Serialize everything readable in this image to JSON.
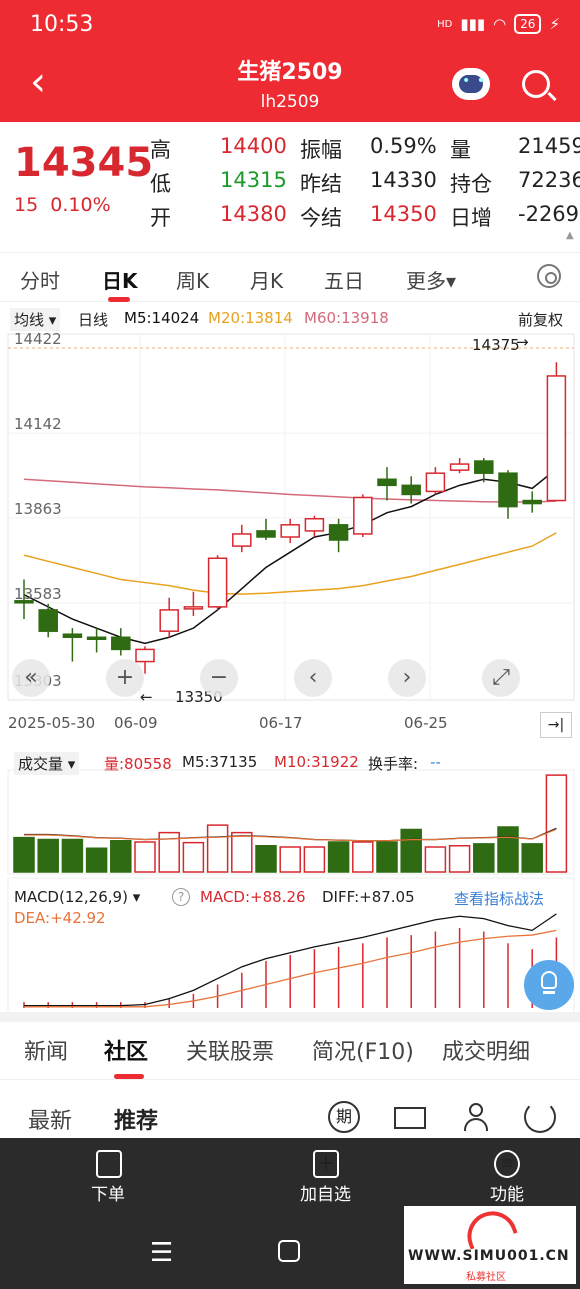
{
  "status": {
    "time": "10:53",
    "battery": "26",
    "signal": "HD",
    "icons": [
      "signal-icon",
      "wifi-icon",
      "battery-icon",
      "charging-icon"
    ]
  },
  "header": {
    "title": "生猪2509",
    "code": "lh2509"
  },
  "quote": {
    "price": "14345",
    "change": "15",
    "change_pct": "0.10%",
    "high_label": "高",
    "high": "14400",
    "low_label": "低",
    "low": "14315",
    "open_label": "开",
    "open": "14380",
    "amp_label": "振幅",
    "amp": "0.59%",
    "prev_settle_label": "昨结",
    "prev_settle": "14330",
    "today_settle_label": "今结",
    "today_settle": "14350",
    "vol_label": "量",
    "vol": "21459",
    "oi_label": "持仓",
    "oi": "72236",
    "oi_chg_label": "日增",
    "oi_chg": "-2269"
  },
  "tabs": [
    {
      "label": "分时"
    },
    {
      "label": "日K"
    },
    {
      "label": "周K"
    },
    {
      "label": "月K"
    },
    {
      "label": "五日"
    },
    {
      "label": "更多▾"
    }
  ],
  "ma_bar": {
    "type": "均线",
    "period": "日线",
    "m5": "M5:14024",
    "m20": "M20:13814",
    "m60": "M60:13918",
    "adjust": "前复权"
  },
  "kline": {
    "y_labels": [
      "14422",
      "14142",
      "13863",
      "13583",
      "13303"
    ],
    "x_labels": [
      "2025-05-30",
      "06-09",
      "06-17",
      "06-25"
    ],
    "max_label": "14375",
    "min_label": "13350",
    "colors": {
      "up": "#d8282f",
      "down": "#2e6b12",
      "m5": "#111111",
      "m20": "#e8a21e",
      "m60": "#d46a7a"
    }
  },
  "chart_data": {
    "type": "candlestick",
    "ylim": [
      13303,
      14422
    ],
    "candles": [
      {
        "o": 13590,
        "c": 13590,
        "h": 13660,
        "l": 13530,
        "up": false
      },
      {
        "o": 13560,
        "c": 13490,
        "h": 13580,
        "l": 13470,
        "up": false
      },
      {
        "o": 13480,
        "c": 13470,
        "h": 13500,
        "l": 13390,
        "up": false
      },
      {
        "o": 13470,
        "c": 13470,
        "h": 13500,
        "l": 13420,
        "up": false
      },
      {
        "o": 13470,
        "c": 13430,
        "h": 13500,
        "l": 13410,
        "up": false
      },
      {
        "o": 13390,
        "c": 13430,
        "h": 13440,
        "l": 13350,
        "up": true
      },
      {
        "o": 13490,
        "c": 13560,
        "h": 13600,
        "l": 13470,
        "up": true
      },
      {
        "o": 13570,
        "c": 13570,
        "h": 13620,
        "l": 13540,
        "up": true
      },
      {
        "o": 13570,
        "c": 13730,
        "h": 13740,
        "l": 13560,
        "up": true
      },
      {
        "o": 13770,
        "c": 13810,
        "h": 13840,
        "l": 13750,
        "up": true
      },
      {
        "o": 13820,
        "c": 13800,
        "h": 13860,
        "l": 13790,
        "up": false
      },
      {
        "o": 13800,
        "c": 13840,
        "h": 13860,
        "l": 13780,
        "up": true
      },
      {
        "o": 13820,
        "c": 13860,
        "h": 13870,
        "l": 13800,
        "up": true
      },
      {
        "o": 13840,
        "c": 13790,
        "h": 13860,
        "l": 13750,
        "up": false
      },
      {
        "o": 13810,
        "c": 13930,
        "h": 13940,
        "l": 13800,
        "up": true
      },
      {
        "o": 13990,
        "c": 13970,
        "h": 14030,
        "l": 13920,
        "up": false
      },
      {
        "o": 13970,
        "c": 13940,
        "h": 14000,
        "l": 13910,
        "up": false
      },
      {
        "o": 13950,
        "c": 14010,
        "h": 14030,
        "l": 13940,
        "up": true
      },
      {
        "o": 14020,
        "c": 14040,
        "h": 14060,
        "l": 14010,
        "up": true
      },
      {
        "o": 14050,
        "c": 14010,
        "h": 14060,
        "l": 13980,
        "up": false
      },
      {
        "o": 14010,
        "c": 13900,
        "h": 14020,
        "l": 13860,
        "up": false
      },
      {
        "o": 13920,
        "c": 13910,
        "h": 13950,
        "l": 13880,
        "up": false
      },
      {
        "o": 13920,
        "c": 14330,
        "h": 14375,
        "l": 13920,
        "up": true
      }
    ],
    "ma5": [
      13610,
      13570,
      13530,
      13500,
      13470,
      13450,
      13470,
      13500,
      13560,
      13630,
      13700,
      13750,
      13800,
      13815,
      13840,
      13880,
      13900,
      13940,
      13970,
      13990,
      13980,
      13960,
      14024
    ],
    "ma20": [
      13740,
      13720,
      13700,
      13680,
      13660,
      13650,
      13640,
      13625,
      13615,
      13612,
      13615,
      13620,
      13625,
      13630,
      13640,
      13655,
      13670,
      13690,
      13710,
      13730,
      13750,
      13770,
      13814
    ],
    "ma60": [
      13990,
      13985,
      13980,
      13975,
      13970,
      13965,
      13962,
      13958,
      13955,
      13950,
      13945,
      13940,
      13936,
      13932,
      13928,
      13925,
      13922,
      13920,
      13918,
      13916,
      13915,
      13915,
      13918
    ],
    "volume": {
      "values": [
        55,
        52,
        52,
        38,
        50,
        48,
        63,
        47,
        75,
        63,
        42,
        40,
        40,
        48,
        48,
        48,
        68,
        40,
        42,
        45,
        72,
        45,
        155
      ],
      "ma_line": [
        60,
        60,
        58,
        55,
        54,
        52,
        53,
        55,
        56,
        58,
        57,
        55,
        52,
        51,
        50,
        50,
        52,
        52,
        54,
        55,
        56,
        53,
        70
      ]
    },
    "macd": {
      "hist": [
        0.05,
        0.05,
        0.05,
        0.05,
        0.05,
        0.05,
        0.08,
        0.12,
        0.2,
        0.3,
        0.4,
        0.45,
        0.5,
        0.52,
        0.55,
        0.6,
        0.62,
        0.65,
        0.68,
        0.65,
        0.55,
        0.5,
        0.6
      ],
      "diff": [
        0.02,
        0.02,
        0.02,
        0.02,
        0.02,
        0.03,
        0.08,
        0.15,
        0.25,
        0.35,
        0.42,
        0.47,
        0.52,
        0.56,
        0.6,
        0.65,
        0.7,
        0.75,
        0.78,
        0.76,
        0.7,
        0.66,
        0.8
      ],
      "dea": [
        0.01,
        0.01,
        0.01,
        0.01,
        0.01,
        0.01,
        0.03,
        0.06,
        0.1,
        0.15,
        0.2,
        0.25,
        0.3,
        0.34,
        0.38,
        0.43,
        0.47,
        0.52,
        0.56,
        0.59,
        0.61,
        0.62,
        0.66
      ]
    }
  },
  "vol_bar": {
    "label": "成交量 ▾",
    "vol": "量:80558",
    "m5": "M5:37135",
    "m10": "M10:31922",
    "turnover": "换手率:",
    "turnover_val": "--"
  },
  "macd_bar": {
    "label": "MACD(12,26,9) ▾",
    "help": "?",
    "macd": "MACD:+88.26",
    "diff": "DIFF:+87.05",
    "dea": "DEA:+42.92",
    "link": "查看指标战法"
  },
  "chart_controls": [
    "«",
    "+",
    "−",
    "‹",
    "›",
    "⤢"
  ],
  "bottom_tabs": [
    {
      "label": "新闻"
    },
    {
      "label": "社区"
    },
    {
      "label": "关联股票"
    },
    {
      "label": "简况(F10)"
    },
    {
      "label": "成交明细"
    }
  ],
  "community": {
    "latest": "最新",
    "recommend": "推荐",
    "period": "期"
  },
  "toolbar": [
    {
      "label": "下单"
    },
    {
      "label": "加自选"
    },
    {
      "label": "功能"
    }
  ],
  "watermark": {
    "text": "WWW.SIMU001.CN",
    "sub": "私募社区"
  }
}
